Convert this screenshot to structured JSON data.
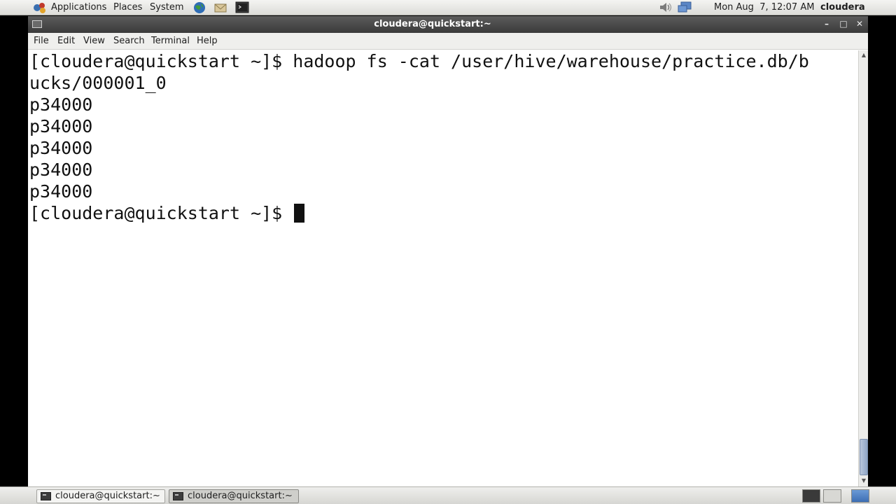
{
  "top_panel": {
    "menus": [
      "Applications",
      "Places",
      "System"
    ],
    "clock": "Mon Aug  7, 12:07 AM",
    "user": "cloudera",
    "launchers": [
      "globe-icon",
      "mail-icon",
      "terminal-launcher-icon"
    ],
    "tray": [
      "volume-icon",
      "network-icon"
    ]
  },
  "window": {
    "title": "cloudera@quickstart:~",
    "menu": [
      "File",
      "Edit",
      "View",
      "Search",
      "Terminal",
      "Help"
    ]
  },
  "terminal": {
    "lines": [
      "[cloudera@quickstart ~]$ hadoop fs -cat /user/hive/warehouse/practice.db/b",
      "ucks/000001_0",
      "p3\u00014000",
      "p3\u00014000",
      "p3\u00014000",
      "p3\u00014000",
      "p3\u00014000"
    ],
    "prompt": "[cloudera@quickstart ~]$ "
  },
  "taskbar": {
    "tasks": [
      "cloudera@quickstart:~",
      "cloudera@quickstart:~"
    ]
  },
  "colors": {
    "titlebar": "#4a4a4a",
    "terminal_bg": "#ffffff",
    "terminal_fg": "#111111",
    "scroll_thumb": "#9fb2d0"
  }
}
